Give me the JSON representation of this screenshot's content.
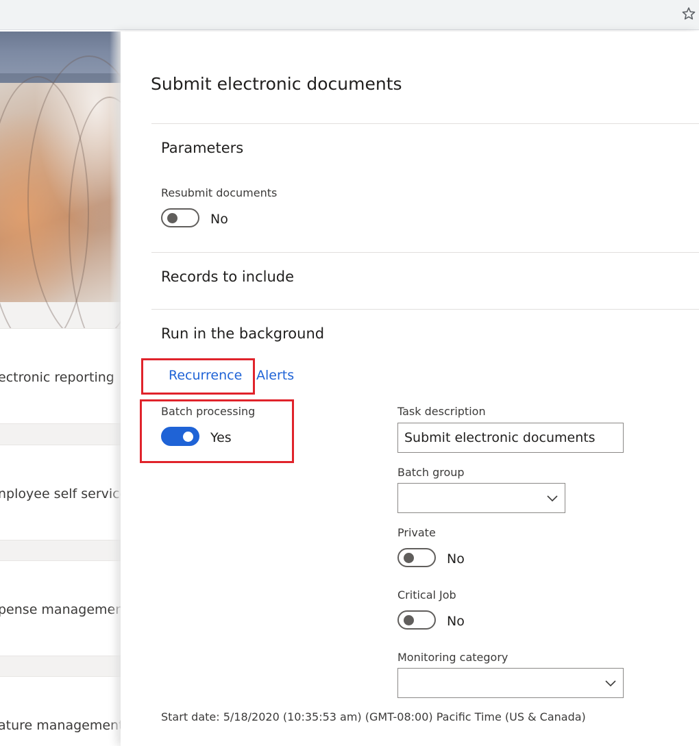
{
  "browser": {
    "bookmark_icon": "star-outline-icon"
  },
  "workspace": {
    "tiles": [
      {
        "label": "ectronic reporting"
      },
      {
        "label": "nployee self service"
      },
      {
        "label": "pense management"
      },
      {
        "label": "ature management"
      }
    ]
  },
  "dialog": {
    "title": "Submit electronic documents",
    "parameters": {
      "heading": "Parameters",
      "resubmit_label": "Resubmit documents",
      "resubmit_value": "No"
    },
    "records": {
      "heading": "Records to include"
    },
    "background": {
      "heading": "Run in the background",
      "tabs": [
        "Recurrence",
        "Alerts"
      ],
      "batch_processing_label": "Batch processing",
      "batch_processing_value": "Yes",
      "task_description_label": "Task description",
      "task_description_value": "Submit electronic documents",
      "batch_group_label": "Batch group",
      "batch_group_value": "",
      "private_label": "Private",
      "private_value": "No",
      "critical_job_label": "Critical Job",
      "critical_job_value": "No",
      "monitoring_category_label": "Monitoring category",
      "monitoring_category_value": ""
    },
    "start_date": "Start date: 5/18/2020 (10:35:53 am) (GMT-08:00) Pacific Time (US & Canada)"
  },
  "colors": {
    "accent": "#1f63d6",
    "highlight": "#e0232b"
  }
}
